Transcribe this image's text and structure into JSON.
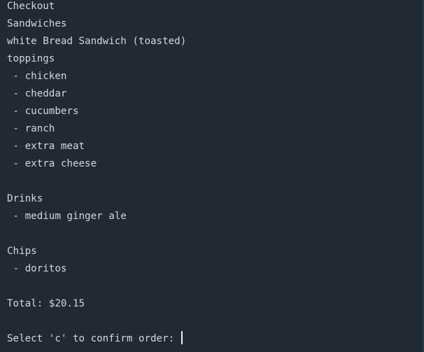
{
  "terminal": {
    "heading": "Checkout",
    "section_sandwiches": "Sandwiches",
    "sandwich": "white Bread Sandwich (toasted)",
    "toppings_label": "toppings",
    "toppings": [
      " - chicken",
      " - cheddar",
      " - cucumbers",
      " - ranch",
      " - extra meat",
      " - extra cheese"
    ],
    "section_drinks": "Drinks",
    "drinks": [
      " - medium ginger ale"
    ],
    "section_chips": "Chips",
    "chips": [
      " - doritos"
    ],
    "total": "Total: $20.15",
    "prompt": "Select 'c' to confirm order: "
  }
}
